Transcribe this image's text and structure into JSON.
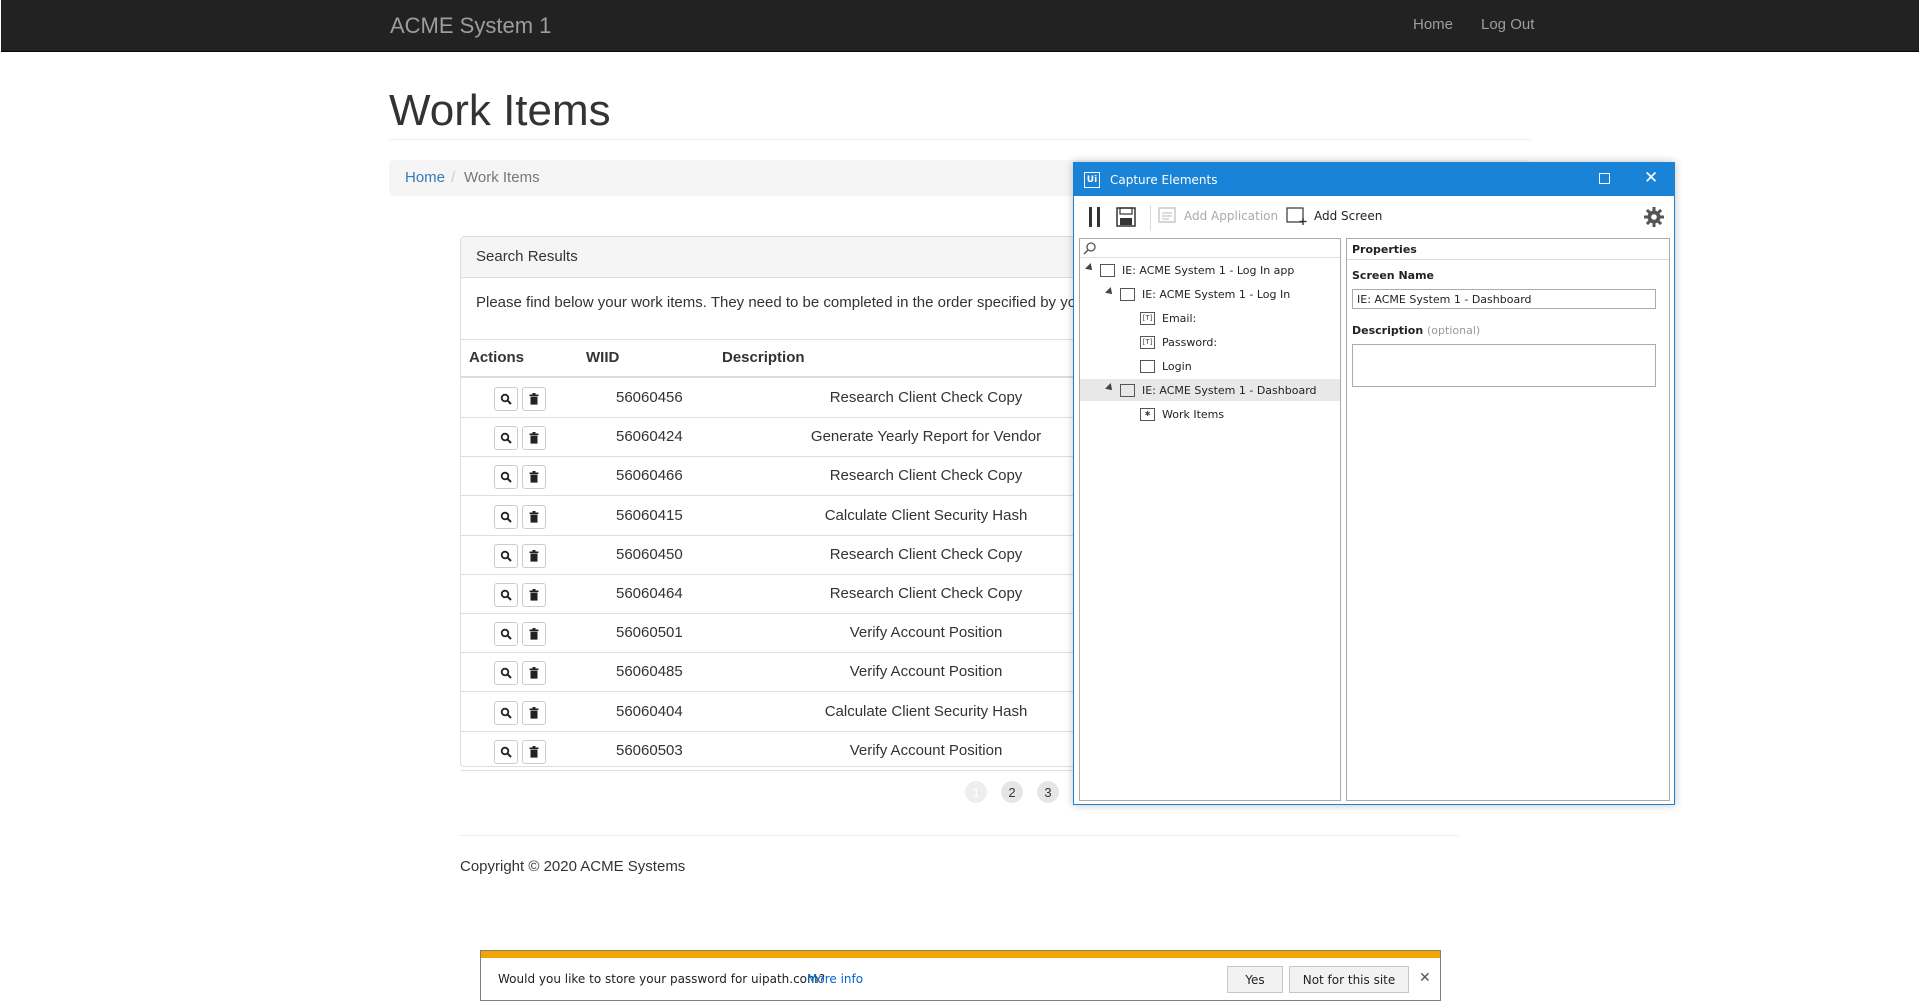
{
  "navbar": {
    "brand": "ACME System 1",
    "links": [
      "Home",
      "Log Out"
    ]
  },
  "page": {
    "title": "Work Items",
    "breadcrumb": [
      "Home",
      "Work Items"
    ]
  },
  "panel": {
    "heading": "Search Results",
    "intro": "Please find below your work items. They need to be completed in the order specified by your ma",
    "columns": [
      "Actions",
      "WIID",
      "Description"
    ],
    "rows": [
      {
        "wiid": "56060456",
        "description": "Research Client Check Copy"
      },
      {
        "wiid": "56060424",
        "description": "Generate Yearly Report for Vendor"
      },
      {
        "wiid": "56060466",
        "description": "Research Client Check Copy"
      },
      {
        "wiid": "56060415",
        "description": "Calculate Client Security Hash"
      },
      {
        "wiid": "56060450",
        "description": "Research Client Check Copy"
      },
      {
        "wiid": "56060464",
        "description": "Research Client Check Copy"
      },
      {
        "wiid": "56060501",
        "description": "Verify Account Position"
      },
      {
        "wiid": "56060485",
        "description": "Verify Account Position"
      },
      {
        "wiid": "56060404",
        "description": "Calculate Client Security Hash"
      },
      {
        "wiid": "56060503",
        "description": "Verify Account Position"
      }
    ],
    "pagination": [
      "1",
      "2",
      "3"
    ],
    "active_page": "1"
  },
  "footer": {
    "copyright": "Copyright © 2020 ACME Systems"
  },
  "password_bar": {
    "message": "Would you like to store your password for uipath.com?",
    "more_info": "More info",
    "yes": "Yes",
    "not_for_site": "Not for this site"
  },
  "dialog": {
    "logo": "Ui",
    "title": "Capture Elements",
    "toolbar": {
      "add_application": "Add Application",
      "add_screen": "Add Screen"
    },
    "tree": [
      {
        "label": "IE: ACME System 1 - Log In app",
        "icon": "app-window-icon"
      },
      {
        "label": "IE: ACME System 1 - Log In",
        "icon": "screen-icon"
      },
      {
        "label": "Email:",
        "icon": "textbox-icon",
        "icon_glyph": "[T]"
      },
      {
        "label": "Password:",
        "icon": "textbox-icon",
        "icon_glyph": "[T]"
      },
      {
        "label": "Login",
        "icon": "button-icon"
      },
      {
        "label": "IE: ACME System 1 - Dashboard",
        "icon": "screen-icon"
      },
      {
        "label": "Work Items",
        "icon": "element-icon",
        "icon_glyph": "✱"
      }
    ],
    "properties": {
      "heading": "Properties",
      "screen_name_label": "Screen Name",
      "screen_name_value": "IE: ACME System 1 - Dashboard",
      "description_label": "Description",
      "description_optional": "(optional)"
    }
  },
  "colors": {
    "navbar_bg": "#222222",
    "dialog_accent": "#1883d7",
    "password_bar_stripe": "#f4a400",
    "link": "#337ab7"
  }
}
